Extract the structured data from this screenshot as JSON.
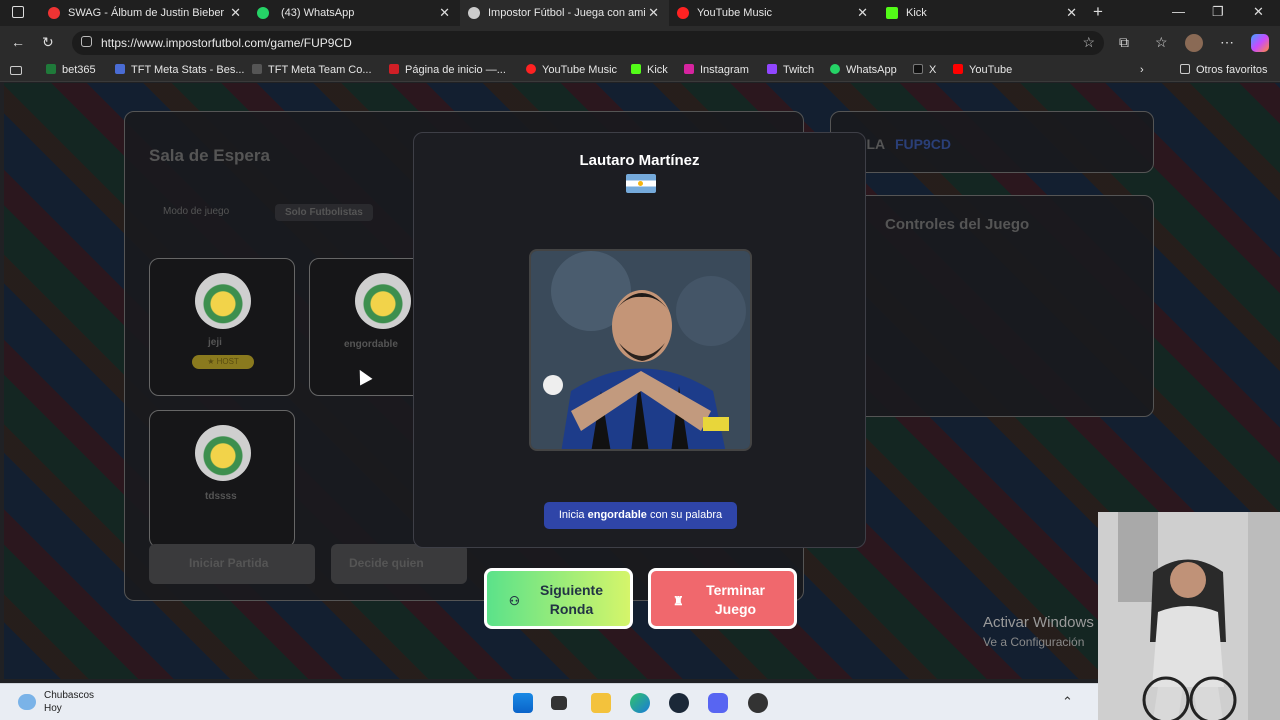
{
  "tabs": [
    {
      "title": "SWAG - Álbum de Justin Bieber",
      "color": "#e33"
    },
    {
      "title": "(43) WhatsApp",
      "color": "#25d366"
    },
    {
      "title": "Impostor Fútbol - Juega con ami",
      "color": "#ccc"
    },
    {
      "title": "YouTube Music",
      "color": "#f22"
    },
    {
      "title": "Kick",
      "color": "#53fc18"
    }
  ],
  "tab_close": "✕",
  "new_tab": "+",
  "window_controls": {
    "minimize": "—",
    "maximize": "❐",
    "close": "✕"
  },
  "address": {
    "url": "https://www.impostorfutbol.com/game/FUP9CD"
  },
  "bookmarks": [
    {
      "label": "bet365",
      "color": "#1f7a3a"
    },
    {
      "label": "TFT Meta Stats - Bes...",
      "color": "#4a6cd4"
    },
    {
      "label": "TFT Meta Team Co...",
      "color": "#444"
    },
    {
      "label": "Página de inicio —...",
      "color": "#d01f26"
    },
    {
      "label": "YouTube Music",
      "color": "#f22"
    },
    {
      "label": "Kick",
      "color": "#53fc18"
    },
    {
      "label": "Instagram",
      "color": "#d6249f"
    },
    {
      "label": "Twitch",
      "color": "#9146ff"
    },
    {
      "label": "WhatsApp",
      "color": "#25d366"
    },
    {
      "label": "X",
      "color": "#111"
    },
    {
      "label": "YouTube",
      "color": "#f00"
    }
  ],
  "other_favorites": "Otros favoritos",
  "background": {
    "waiting_room_title": "Sala de Espera",
    "game_mode_label": "Modo de juego",
    "game_mode_value": "Solo Futbolistas",
    "room_label": "SALA",
    "room_code": "FUP9CD",
    "controls_title": "Controles del Juego",
    "player_cards": [
      {
        "name": "jeji",
        "badge": "★ HOST"
      },
      {
        "name": "engordable",
        "badge": ""
      },
      {
        "name": "tdssss",
        "badge": ""
      }
    ],
    "start_button": "Iniciar Partida",
    "decide_button": "Decide quien"
  },
  "modal": {
    "player_name": "Lautaro Martínez",
    "flag": "argentina-flag",
    "hint_prefix": "Inicia",
    "hint_player": "engordable",
    "hint_suffix": "con su palabra"
  },
  "buttons": {
    "next_round": "Siguiente Ronda",
    "end_game": "Terminar Juego"
  },
  "watermark": {
    "line1": "Activar Windows",
    "line2": "Ve a Configuración"
  },
  "taskbar": {
    "weather_title": "Chubascos",
    "weather_sub": "Hoy"
  }
}
